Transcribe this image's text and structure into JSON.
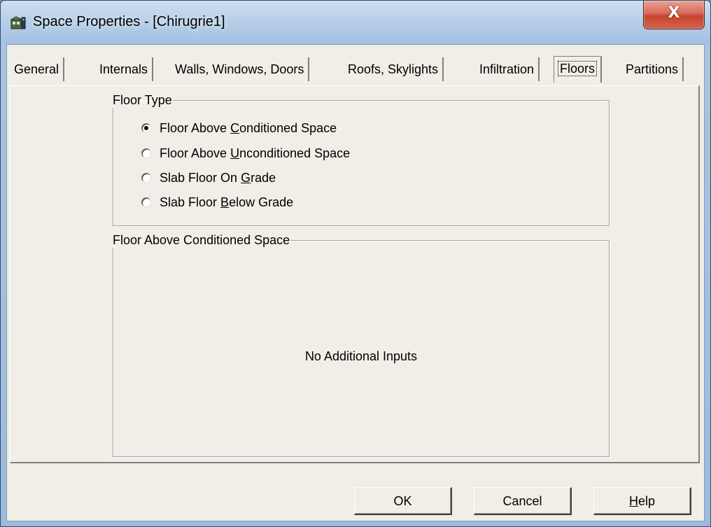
{
  "window": {
    "title": "Space Properties - [Chirugrie1]",
    "close_label": "X"
  },
  "tabs": [
    {
      "label": "General",
      "active": false
    },
    {
      "label": "Internals",
      "active": false
    },
    {
      "label": "Walls, Windows, Doors",
      "active": false
    },
    {
      "label": "Roofs, Skylights",
      "active": false
    },
    {
      "label": "Infiltration",
      "active": false
    },
    {
      "label": "Floors",
      "active": true
    },
    {
      "label": "Partitions",
      "active": false
    }
  ],
  "floor_type": {
    "legend": "Floor Type",
    "selected": "Floor Above Conditioned Space",
    "options": [
      {
        "label_pre": "Floor Above ",
        "accel": "C",
        "label_post": "onditioned Space",
        "checked": true
      },
      {
        "label_pre": "Floor Above ",
        "accel": "U",
        "label_post": "nconditioned Space",
        "checked": false
      },
      {
        "label_pre": "Slab Floor On ",
        "accel": "G",
        "label_post": "rade",
        "checked": false
      },
      {
        "label_pre": "Slab Floor ",
        "accel": "B",
        "label_post": "elow Grade",
        "checked": false
      }
    ]
  },
  "detail_group": {
    "legend": "Floor Above Conditioned Space",
    "message": "No Additional Inputs"
  },
  "buttons": {
    "ok": "OK",
    "cancel": "Cancel",
    "help_accel": "H",
    "help_rest": "elp"
  },
  "colors": {
    "dialog_face": "#f0eee6",
    "close_button": "#c7452f",
    "titlebar": "#b7cfe8"
  }
}
